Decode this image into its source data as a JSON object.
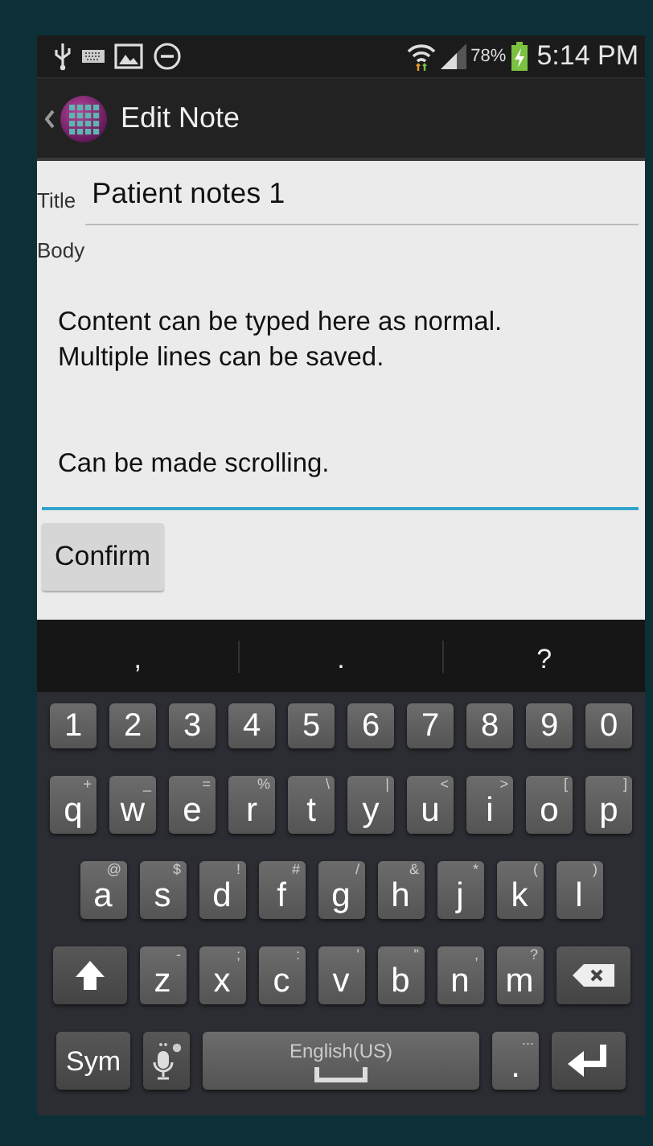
{
  "status_bar": {
    "battery": "78%",
    "time": "5:14 PM"
  },
  "action_bar": {
    "title": "Edit Note"
  },
  "form": {
    "title_label": "Title",
    "title_value": "Patient notes 1",
    "body_label": "Body",
    "body_value": "Content can be typed here as normal.\nMultiple lines can be saved.\n\n\nCan be made scrolling.",
    "body_focused": true,
    "confirm_button": "Confirm"
  },
  "suggestions": [
    ",",
    ".",
    "?"
  ],
  "keyboard": {
    "rows": [
      {
        "keys": [
          {
            "kind": "char",
            "label": "1"
          },
          {
            "kind": "char",
            "label": "2"
          },
          {
            "kind": "char",
            "label": "3"
          },
          {
            "kind": "char",
            "label": "4"
          },
          {
            "kind": "char",
            "label": "5"
          },
          {
            "kind": "char",
            "label": "6"
          },
          {
            "kind": "char",
            "label": "7"
          },
          {
            "kind": "char",
            "label": "8"
          },
          {
            "kind": "char",
            "label": "9"
          },
          {
            "kind": "char",
            "label": "0"
          }
        ]
      },
      {
        "keys": [
          {
            "kind": "char",
            "label": "q",
            "hint": "+"
          },
          {
            "kind": "char",
            "label": "w",
            "hint": "_"
          },
          {
            "kind": "char",
            "label": "e",
            "hint": "="
          },
          {
            "kind": "char",
            "label": "r",
            "hint": "%"
          },
          {
            "kind": "char",
            "label": "t",
            "hint": "\\"
          },
          {
            "kind": "char",
            "label": "y",
            "hint": "|"
          },
          {
            "kind": "char",
            "label": "u",
            "hint": "<"
          },
          {
            "kind": "char",
            "label": "i",
            "hint": ">"
          },
          {
            "kind": "char",
            "label": "o",
            "hint": "["
          },
          {
            "kind": "char",
            "label": "p",
            "hint": "]"
          }
        ]
      },
      {
        "keys": [
          {
            "kind": "char",
            "label": "a",
            "hint": "@"
          },
          {
            "kind": "char",
            "label": "s",
            "hint": "$"
          },
          {
            "kind": "char",
            "label": "d",
            "hint": "!"
          },
          {
            "kind": "char",
            "label": "f",
            "hint": "#"
          },
          {
            "kind": "char",
            "label": "g",
            "hint": "/"
          },
          {
            "kind": "char",
            "label": "h",
            "hint": "&"
          },
          {
            "kind": "char",
            "label": "j",
            "hint": "*"
          },
          {
            "kind": "char",
            "label": "k",
            "hint": "("
          },
          {
            "kind": "char",
            "label": "l",
            "hint": ")"
          }
        ]
      },
      {
        "keys": [
          {
            "kind": "shift"
          },
          {
            "kind": "char",
            "label": "z",
            "hint": "-"
          },
          {
            "kind": "char",
            "label": "x",
            "hint": ";"
          },
          {
            "kind": "char",
            "label": "c",
            "hint": ":"
          },
          {
            "kind": "char",
            "label": "v",
            "hint": "'"
          },
          {
            "kind": "char",
            "label": "b",
            "hint": "\""
          },
          {
            "kind": "char",
            "label": "n",
            "hint": ","
          },
          {
            "kind": "char",
            "label": "m",
            "hint": "?"
          },
          {
            "kind": "backspace"
          }
        ]
      },
      {
        "keys": [
          {
            "kind": "sym",
            "label": "Sym"
          },
          {
            "kind": "mic"
          },
          {
            "kind": "space",
            "label": "English(US)"
          },
          {
            "kind": "char",
            "label": ".",
            "hint": "..."
          },
          {
            "kind": "enter"
          }
        ]
      }
    ]
  }
}
